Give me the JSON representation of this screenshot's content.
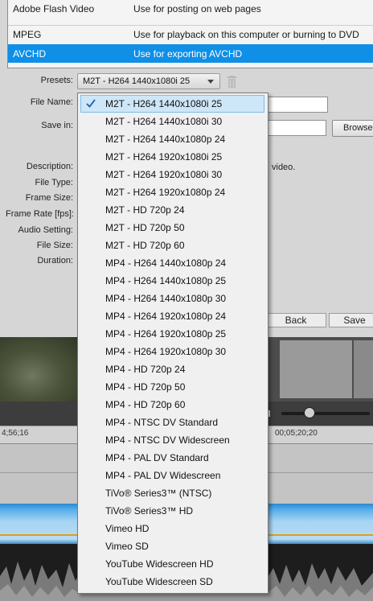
{
  "formats": [
    {
      "name": "Adobe Flash Video",
      "use": "Use for posting on web pages"
    },
    {
      "name": "MPEG",
      "use": "Use for playback on this computer or burning to DVD"
    },
    {
      "name": "AVCHD",
      "use": "Use for exporting AVCHD",
      "selected": true
    }
  ],
  "form": {
    "presets_label": "Presets:",
    "presets_value": "M2T - H264 1440x1080i 25",
    "file_name_label": "File Name:",
    "save_in_label": "Save in:",
    "browse_label": "Browse...",
    "description_label": "Description:",
    "description_tail": "video.",
    "file_type_label": "File Type:",
    "frame_size_label": "Frame Size:",
    "frame_rate_label": "Frame Rate [fps]:",
    "audio_setting_label": "Audio Setting:",
    "file_size_label": "File Size:",
    "duration_label": "Duration:"
  },
  "buttons": {
    "back": "Back",
    "save": "Save"
  },
  "timeline": {
    "tc_left": "4;56;16",
    "tc_right": "00;05;20;20"
  },
  "presets": [
    "M2T - H264 1440x1080i 25",
    "M2T - H264 1440x1080i 30",
    "M2T - H264 1440x1080p 24",
    "M2T - H264 1920x1080i 25",
    "M2T - H264 1920x1080i 30",
    "M2T - H264 1920x1080p 24",
    "M2T - HD 720p 24",
    "M2T - HD 720p 50",
    "M2T - HD 720p 60",
    "MP4 - H264 1440x1080p 24",
    "MP4 - H264 1440x1080p 25",
    "MP4 - H264 1440x1080p 30",
    "MP4 - H264 1920x1080p 24",
    "MP4 - H264 1920x1080p 25",
    "MP4 - H264 1920x1080p 30",
    "MP4 - HD 720p 24",
    "MP4 - HD 720p 50",
    "MP4 - HD 720p 60",
    "MP4 - NTSC DV Standard",
    "MP4 - NTSC DV Widescreen",
    "MP4 - PAL DV Standard",
    "MP4 - PAL DV Widescreen",
    "TiVo® Series3™ (NTSC)",
    "TiVo® Series3™ HD",
    "Vimeo HD",
    "Vimeo SD",
    "YouTube Widescreen HD",
    "YouTube Widescreen SD"
  ],
  "selected_preset_index": 0,
  "icons": {
    "check": "checkmark-icon",
    "trash": "trash-icon",
    "caret": "chevron-down-icon"
  },
  "colors": {
    "selection_blue": "#0f8fe6",
    "hover_blue": "#cde6f8"
  }
}
